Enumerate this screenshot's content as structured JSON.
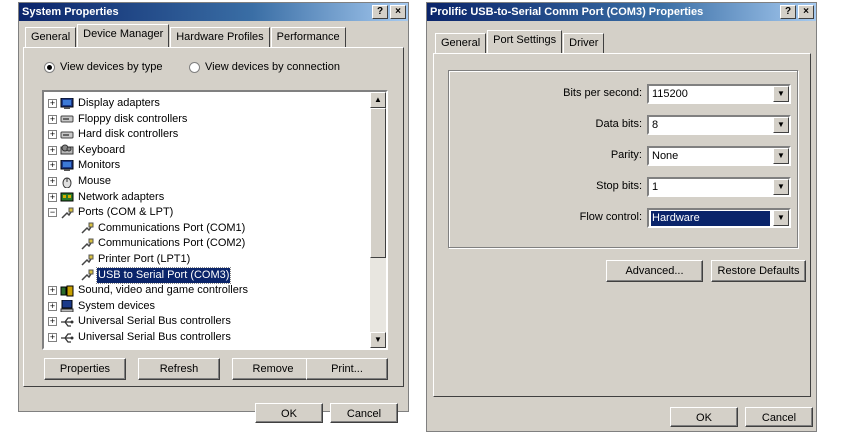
{
  "left": {
    "title": "System Properties",
    "title_buttons": [
      "?",
      "×"
    ],
    "tabs": [
      "General",
      "Device Manager",
      "Hardware Profiles",
      "Performance"
    ],
    "view_by_type": "View devices by type",
    "view_by_connection": "View devices by connection",
    "tree": [
      {
        "label": "Display adapters",
        "icon": "monitor-icon",
        "toggle": "+"
      },
      {
        "label": "Floppy disk controllers",
        "icon": "disk-controller-icon",
        "toggle": "+"
      },
      {
        "label": "Hard disk controllers",
        "icon": "disk-controller-icon",
        "toggle": "+"
      },
      {
        "label": "Keyboard",
        "icon": "keyboard-icon",
        "toggle": "+"
      },
      {
        "label": "Monitors",
        "icon": "monitor-icon",
        "toggle": "+"
      },
      {
        "label": "Mouse",
        "icon": "mouse-icon",
        "toggle": "+"
      },
      {
        "label": "Network adapters",
        "icon": "network-adapter-icon",
        "toggle": "+"
      },
      {
        "label": "Ports (COM & LPT)",
        "icon": "port-icon",
        "toggle": "−"
      },
      {
        "label": "Communications Port (COM1)",
        "icon": "port-icon",
        "child": true
      },
      {
        "label": "Communications Port (COM2)",
        "icon": "port-icon",
        "child": true
      },
      {
        "label": "Printer Port (LPT1)",
        "icon": "port-icon",
        "child": true
      },
      {
        "label": "USB to Serial Port (COM3)",
        "icon": "port-icon",
        "child": true,
        "selected": true
      },
      {
        "label": "Sound, video and game controllers",
        "icon": "sound-icon",
        "toggle": "+"
      },
      {
        "label": "System devices",
        "icon": "computer-icon",
        "toggle": "+"
      },
      {
        "label": "Universal Serial Bus controllers",
        "icon": "usb-icon",
        "toggle": "+"
      },
      {
        "label": "Universal Serial Bus controllers",
        "icon": "usb-icon",
        "toggle": "+"
      }
    ],
    "buttons": {
      "properties": "Properties",
      "refresh": "Refresh",
      "remove": "Remove",
      "print": "Print..."
    },
    "ok": "OK",
    "cancel": "Cancel"
  },
  "right": {
    "title": "Prolific USB-to-Serial Comm Port (COM3) Properties",
    "title_buttons": [
      "?",
      "×"
    ],
    "tabs": [
      "General",
      "Port Settings",
      "Driver"
    ],
    "fields": [
      {
        "label": "Bits per second:",
        "value": "115200"
      },
      {
        "label": "Data bits:",
        "value": "8"
      },
      {
        "label": "Parity:",
        "value": "None"
      },
      {
        "label": "Stop bits:",
        "value": "1"
      },
      {
        "label": "Flow control:",
        "value": "Hardware",
        "highlighted": true
      }
    ],
    "advanced": "Advanced...",
    "restore": "Restore Defaults",
    "ok": "OK",
    "cancel": "Cancel"
  }
}
